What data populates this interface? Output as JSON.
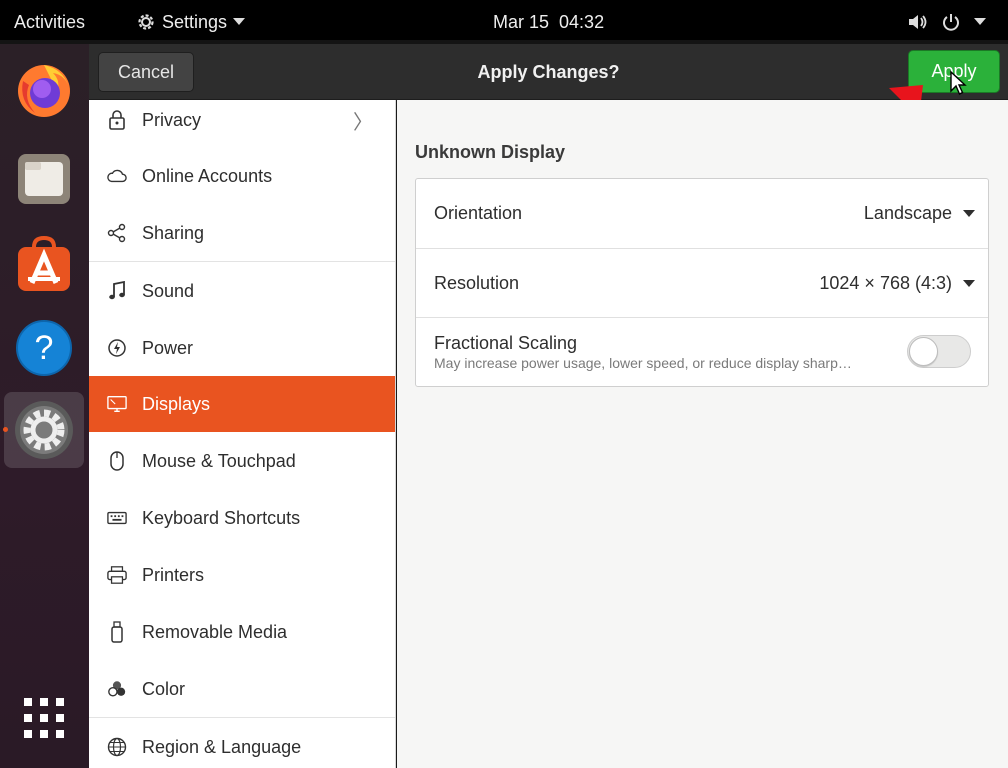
{
  "topbar": {
    "activities": "Activities",
    "app_menu": "Settings",
    "date": "Mar 15",
    "time": "04:32"
  },
  "dock": {
    "items": [
      "firefox-icon",
      "files-icon",
      "software-icon",
      "help-icon",
      "settings-icon"
    ],
    "active": "settings-icon"
  },
  "header": {
    "cancel_label": "Cancel",
    "title": "Apply Changes?",
    "apply_label": "Apply"
  },
  "sidebar": {
    "items": [
      {
        "label": "Privacy",
        "icon": "lock-icon"
      },
      {
        "label": "Online Accounts",
        "icon": "cloud-icon"
      },
      {
        "label": "Sharing",
        "icon": "share-icon"
      },
      {
        "label": "Sound",
        "icon": "music-note-icon"
      },
      {
        "label": "Power",
        "icon": "power-icon"
      },
      {
        "label": "Displays",
        "icon": "display-icon"
      },
      {
        "label": "Mouse & Touchpad",
        "icon": "mouse-icon"
      },
      {
        "label": "Keyboard Shortcuts",
        "icon": "keyboard-icon"
      },
      {
        "label": "Printers",
        "icon": "printer-icon"
      },
      {
        "label": "Removable Media",
        "icon": "usb-icon"
      },
      {
        "label": "Color",
        "icon": "color-icon"
      },
      {
        "label": "Region & Language",
        "icon": "globe-icon"
      }
    ],
    "selected": "Displays"
  },
  "main": {
    "display_name": "Unknown Display",
    "orientation_label": "Orientation",
    "orientation_value": "Landscape",
    "resolution_label": "Resolution",
    "resolution_value": "1024 × 768 (4:3)",
    "scaling_label": "Fractional Scaling",
    "scaling_desc": "May increase power usage, lower speed, or reduce display sharp…",
    "scaling_enabled": false
  },
  "colors": {
    "accent": "#e95420",
    "apply": "#2bb13a",
    "annotation": "#e8141c"
  }
}
